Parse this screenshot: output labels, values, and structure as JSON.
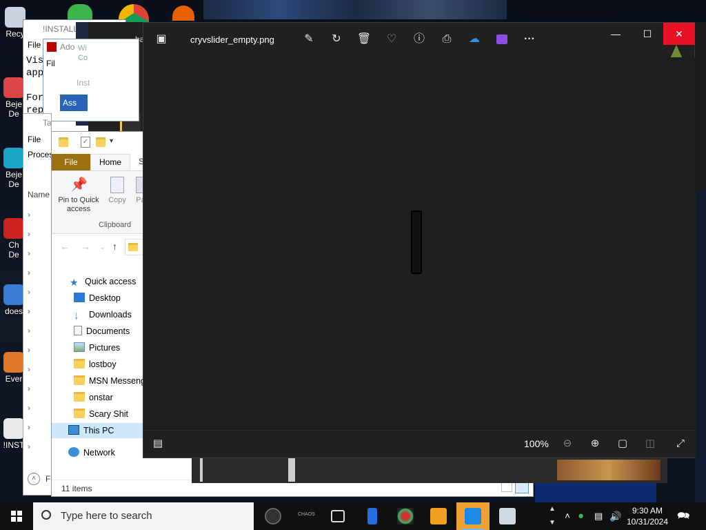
{
  "desktop": {
    "icons": [
      {
        "label": "Recy",
        "color": "#c9d2dd"
      },
      {
        "label": "Beje\nDe",
        "color": "#d44"
      },
      {
        "label": "Beje\nDe",
        "color": "#1aa4c8"
      },
      {
        "label": "Ch\nDe",
        "color": "#c22"
      },
      {
        "label": "does",
        "color": "#3a7bd5"
      },
      {
        "label": "Ever",
        "color": "#e07a2a"
      },
      {
        "label": "!INST",
        "color": "#e8e8e8"
      }
    ]
  },
  "notepad": {
    "title": "!INSTALL",
    "menu": "File",
    "body": "Vis\napp\n\nFor\nrep"
  },
  "adobe": {
    "title": "Ado",
    "sub": "Wi\nCo",
    "menu": "Fil",
    "install_label": "Inst",
    "tab": "Ass"
  },
  "task_manager": {
    "title": "Task Manage",
    "menu": "File",
    "tabs": "Proces",
    "column": "Name",
    "bottom_label": "F"
  },
  "explorer": {
    "ribbon_tabs": {
      "file": "File",
      "home": "Home",
      "share": "S"
    },
    "ribbon": {
      "pin_label": "Pin to Quick access",
      "copy_label": "Copy",
      "paste_label": "Pa",
      "group_label": "Clipboard"
    },
    "nav": [
      {
        "label": "Quick access",
        "icon": "star-icon"
      },
      {
        "label": "Desktop",
        "icon": "desktop-icon"
      },
      {
        "label": "Downloads",
        "icon": "download-icon"
      },
      {
        "label": "Documents",
        "icon": "documents-icon"
      },
      {
        "label": "Pictures",
        "icon": "pictures-icon"
      },
      {
        "label": "lostboy",
        "icon": "folder-icon"
      },
      {
        "label": "MSN Messenge",
        "icon": "folder-icon"
      },
      {
        "label": "onstar",
        "icon": "folder-icon"
      },
      {
        "label": "Scary Shit",
        "icon": "folder-icon"
      },
      {
        "label": "This PC",
        "icon": "computer-icon"
      },
      {
        "label": "Network",
        "icon": "network-icon"
      }
    ],
    "status": "11 items"
  },
  "viewer": {
    "filename": "cryvslider_empty.png",
    "zoom": "100%",
    "tab_label": "ba",
    "accent_close": "#e81123"
  },
  "taskbar": {
    "search_placeholder": "Type here to search",
    "time": "9:30 AM",
    "date": "10/31/2024",
    "app_label_chaos": "CHAOS"
  }
}
